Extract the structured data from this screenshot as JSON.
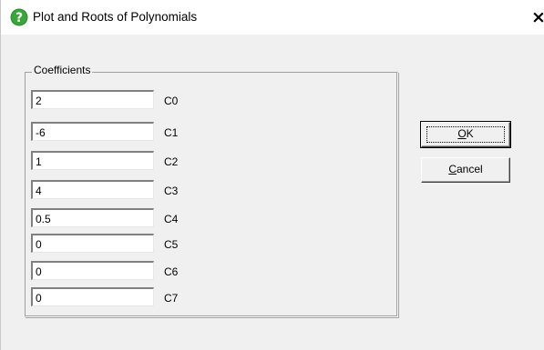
{
  "window": {
    "title": "Plot and Roots of Polynomials",
    "icon": "help-question-icon",
    "close_glyph": "×"
  },
  "group": {
    "label": "Coefficients",
    "coefficients": [
      {
        "name": "C0",
        "value": "2"
      },
      {
        "name": "C1",
        "value": "-6"
      },
      {
        "name": "C2",
        "value": "1"
      },
      {
        "name": "C3",
        "value": "4"
      },
      {
        "name": "C4",
        "value": "0.5"
      },
      {
        "name": "C5",
        "value": "0"
      },
      {
        "name": "C6",
        "value": "0"
      },
      {
        "name": "C7",
        "value": "0"
      }
    ]
  },
  "buttons": {
    "ok": {
      "mnemonic": "O",
      "rest": "K"
    },
    "cancel": {
      "mnemonic": "C",
      "rest": "ancel"
    }
  },
  "colors": {
    "dialog_face": "#f0f0f0",
    "icon_green": "#2e8b2e"
  }
}
